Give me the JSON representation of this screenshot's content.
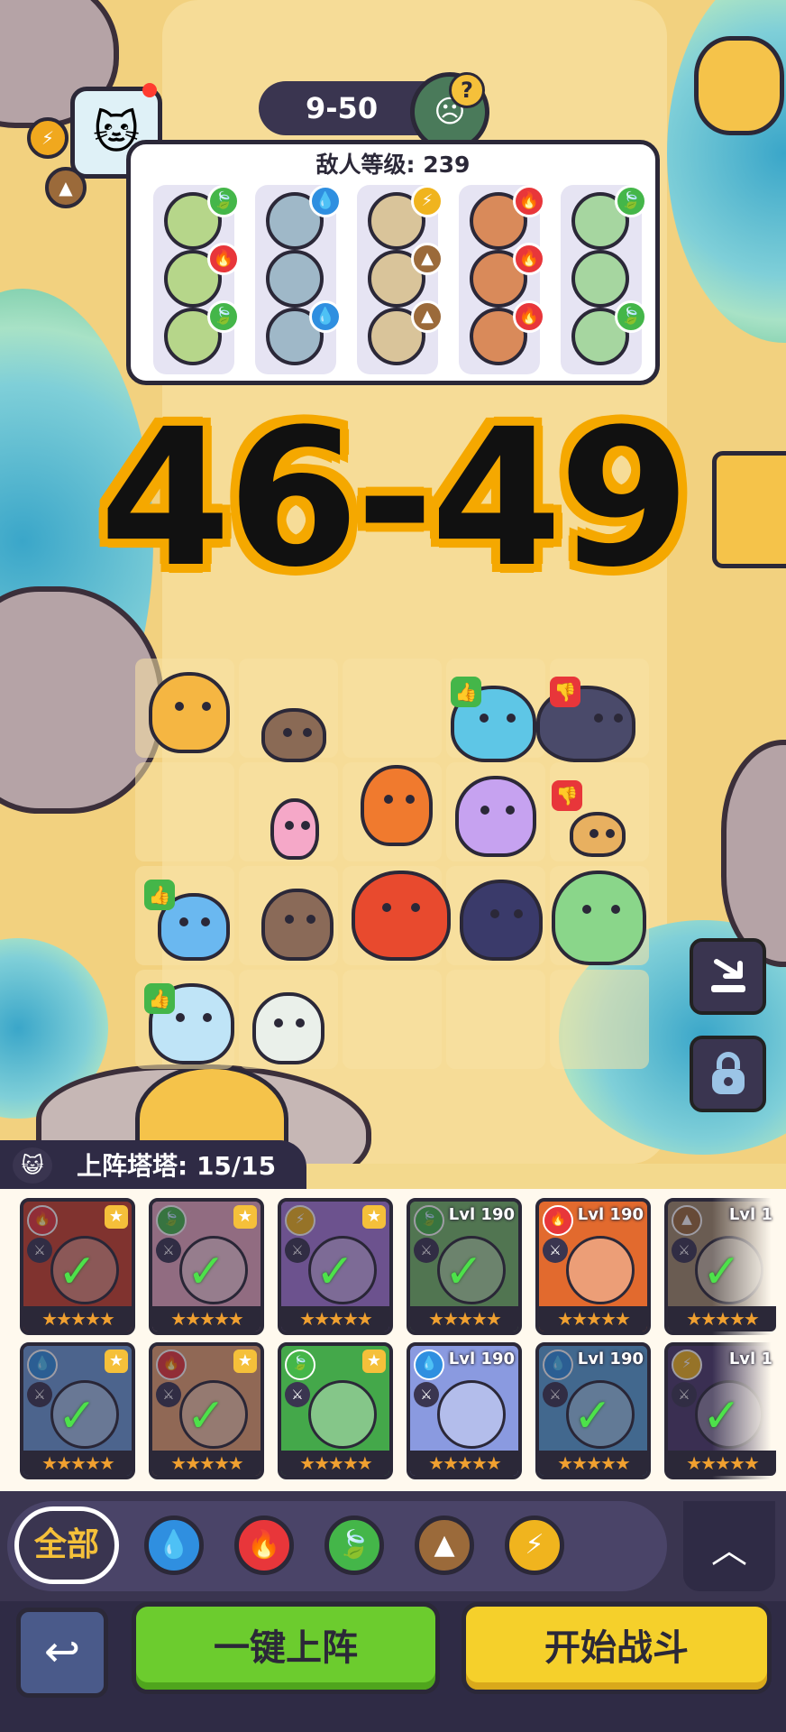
{
  "stage": {
    "label": "9-50",
    "help_glyph": "?"
  },
  "enemy_panel": {
    "title": "敌人等级: 239",
    "columns": [
      {
        "elements": [
          "leaf",
          "fire",
          "leaf"
        ]
      },
      {
        "elements": [
          "water",
          "none",
          "water"
        ]
      },
      {
        "elements": [
          "thunder",
          "earth",
          "earth"
        ]
      },
      {
        "elements": [
          "fire",
          "fire",
          "fire"
        ]
      },
      {
        "elements": [
          "leaf",
          "none",
          "leaf"
        ]
      }
    ]
  },
  "big_counter": "46-49",
  "deploy": {
    "label": "上阵塔塔: 15/15"
  },
  "cards_row1": [
    {
      "element": "fire",
      "level": "",
      "fav": true,
      "selected": true,
      "stars": "★★★★★",
      "color": "#c9412a"
    },
    {
      "element": "leaf",
      "level": "",
      "fav": true,
      "selected": true,
      "stars": "★★★★★",
      "color": "#e8a8c0"
    },
    {
      "element": "thunder",
      "level": "",
      "fav": true,
      "selected": true,
      "stars": "★★★★★",
      "color": "#a478d8"
    },
    {
      "element": "leaf",
      "level": "Lvl 190",
      "fav": false,
      "selected": true,
      "stars": "★★★★★",
      "color": "#74b868"
    },
    {
      "element": "fire",
      "level": "Lvl 190",
      "fav": false,
      "selected": false,
      "stars": "★★★★★",
      "color": "#e26a2e"
    },
    {
      "element": "earth",
      "level": "Lvl 1",
      "fav": false,
      "selected": true,
      "stars": "★★★★★",
      "color": "#a08a6a"
    }
  ],
  "cards_row2": [
    {
      "element": "water",
      "level": "",
      "fav": true,
      "selected": true,
      "stars": "★★★★★",
      "color": "#6a9ad6"
    },
    {
      "element": "fire",
      "level": "",
      "fav": true,
      "selected": true,
      "stars": "★★★★★",
      "color": "#e6a070"
    },
    {
      "element": "leaf",
      "level": "",
      "fav": true,
      "selected": false,
      "stars": "★★★★★",
      "color": "#44a84a"
    },
    {
      "element": "water",
      "level": "Lvl 190",
      "fav": false,
      "selected": false,
      "stars": "★★★★★",
      "color": "#8a9ae0"
    },
    {
      "element": "water",
      "level": "Lvl 190",
      "fav": false,
      "selected": true,
      "stars": "★★★★★",
      "color": "#58a0d8"
    },
    {
      "element": "thunder",
      "level": "Lvl 1",
      "fav": false,
      "selected": true,
      "stars": "★★★★★",
      "color": "#4a3a6a"
    }
  ],
  "filters": {
    "all_label": "全部",
    "items": [
      "water",
      "fire",
      "leaf",
      "earth",
      "thunder"
    ]
  },
  "buttons": {
    "auto_deploy": "一键上阵",
    "start_battle": "开始战斗"
  },
  "colors": {
    "water": "#2f8fe0",
    "fire": "#e8363a",
    "leaf": "#44b649",
    "earth": "#9b6a3a",
    "thunder": "#f0b41e",
    "none": "#8a8aa0",
    "thumb_up": "#44b649",
    "thumb_down": "#e8363a"
  },
  "icons": {
    "water": "💧",
    "fire": "🔥",
    "leaf": "🍃",
    "earth": "▲",
    "thunder": "⚡",
    "none": "",
    "check": "✓",
    "role": "⚔"
  }
}
